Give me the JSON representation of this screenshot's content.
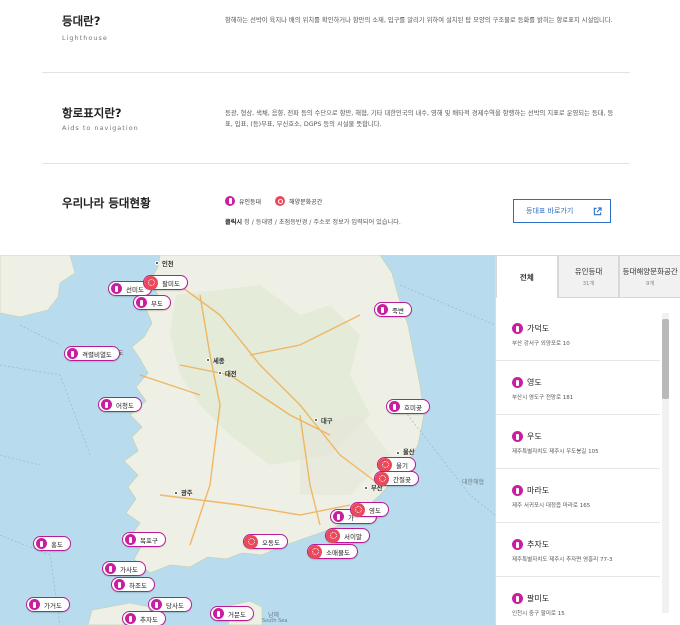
{
  "sections": {
    "lighthouse": {
      "title": "등대란?",
      "subtitle": "Lighthouse",
      "desc": "항해하는 선박이 육지나 배의 위치를 확인하거나 항만의 소재, 입구를 알리기 위하여 설치된 탑 모양의 구조물로 등화를 밝히는 항로표지 시설입니다."
    },
    "aids": {
      "title": "항로표지란?",
      "subtitle": "Aids to navigation",
      "desc": "등광, 형상, 색채, 음향, 전파 등의 수단으로 항만, 해협, 기타 대한민국의 내수, 영해 및 배타적 경제수역을 항행하는 선박의 지표로 운영되는 등대, 등표, 입표, (등)부표, 무신호소, DGPS 등의 시설물 뜻합니다."
    },
    "status": {
      "title": "우리나라 등대현황",
      "legend_manned": "유인등대",
      "legend_culture": "해양문화공간",
      "hint_bold": "클릭시",
      "hint_rest": " 정 / 등대명 / 초점등반경 / 주소로 정보가 입력되어 있습니다.",
      "button_label": "등대표 바로가기"
    }
  },
  "map": {
    "pins": [
      {
        "name": "팔미도",
        "type": "culture"
      },
      {
        "name": "선미도",
        "type": "manned"
      },
      {
        "name": "부도",
        "type": "manned"
      },
      {
        "name": "격렬비열도",
        "type": "manned"
      },
      {
        "name": "어청도",
        "type": "manned"
      },
      {
        "name": "죽변",
        "type": "manned"
      },
      {
        "name": "호미곶",
        "type": "manned"
      },
      {
        "name": "울기",
        "type": "culture"
      },
      {
        "name": "간절곶",
        "type": "culture"
      },
      {
        "name": "영도",
        "type": "culture"
      },
      {
        "name": "서이말",
        "type": "culture"
      },
      {
        "name": "소매물도",
        "type": "culture"
      },
      {
        "name": "오동도",
        "type": "culture"
      },
      {
        "name": "목포구",
        "type": "manned"
      },
      {
        "name": "홍도",
        "type": "manned"
      },
      {
        "name": "가사도",
        "type": "manned"
      },
      {
        "name": "하조도",
        "type": "manned"
      },
      {
        "name": "가거도",
        "type": "manned"
      },
      {
        "name": "당사도",
        "type": "manned"
      },
      {
        "name": "거문도",
        "type": "manned"
      },
      {
        "name": "추자도",
        "type": "manned"
      }
    ],
    "partial_labels": {
      "yeongdo_tail": "도",
      "seomal_tail": "가",
      "gyeok_tail": "도"
    },
    "cities": {
      "incheon": "인천",
      "sejong": "세종",
      "daejeon": "대전",
      "daegu": "대구",
      "ulsan": "울산",
      "gwangju": "광주",
      "busan": "부산"
    },
    "sea_labels": {
      "south_sea": "남해",
      "south_sea_en": "South Sea",
      "east_channel": "대한해협"
    }
  },
  "panel": {
    "tabs": [
      {
        "label": "전체",
        "count": ""
      },
      {
        "label": "유인등대",
        "count": "31개"
      },
      {
        "label": "등대해양문화공간",
        "count": "9개"
      }
    ],
    "items": [
      {
        "name": "가덕도",
        "address": "부산 강서구 외양포로 10"
      },
      {
        "name": "영도",
        "address": "부산시 영도구 전망로 181"
      },
      {
        "name": "우도",
        "address": "제주특별자치도 제주시 우도봉길 105"
      },
      {
        "name": "마라도",
        "address": "제주 서귀포시 대정읍 마라로 165"
      },
      {
        "name": "추자도",
        "address": "제주특별자치도 제주시 추자면 영흥리 77-3"
      },
      {
        "name": "팔미도",
        "address": "인천시 중구 팔미로 15"
      }
    ]
  },
  "colors": {
    "manned": "#c81ea0",
    "culture": "#e9495a",
    "accent": "#2d6fc7",
    "sea": "#b8dced",
    "land": "#eef0e6"
  },
  "icons": {
    "manned": "lighthouse-icon",
    "culture": "culture-space-icon",
    "external": "external-link-icon"
  }
}
